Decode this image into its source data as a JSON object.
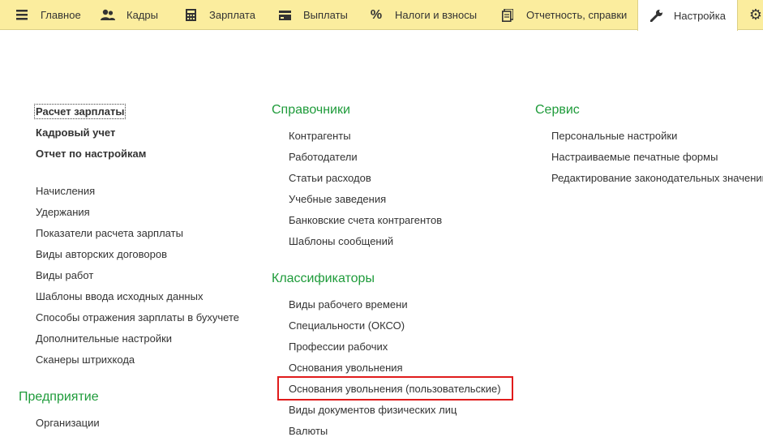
{
  "nav": {
    "tabs": [
      {
        "label": "Главное",
        "icon": "hamburger-menu-icon"
      },
      {
        "label": "Кадры",
        "icon": "people-icon"
      },
      {
        "label": "Зарплата",
        "icon": "calculator-icon"
      },
      {
        "label": "Выплаты",
        "icon": "wallet-icon"
      },
      {
        "label": "Налоги и взносы",
        "icon": "percent-icon"
      },
      {
        "label": "Отчетность, справки",
        "icon": "documents-icon"
      },
      {
        "label": "Настройка",
        "icon": "wrench-icon"
      }
    ],
    "extra_icon": "gear-icon"
  },
  "left": {
    "bold_links": [
      "Расчет зарплаты",
      "Кадровый учет",
      "Отчет по настройкам"
    ],
    "links": [
      "Начисления",
      "Удержания",
      "Показатели расчета зарплаты",
      "Виды авторских договоров",
      "Виды работ",
      "Шаблоны ввода исходных данных",
      "Способы отражения зарплаты в бухучете",
      "Дополнительные настройки",
      "Сканеры штрихкода"
    ],
    "section2_title": "Предприятие",
    "section2_links": [
      "Организации"
    ]
  },
  "middle": {
    "section1_title": "Справочники",
    "section1_links": [
      "Контрагенты",
      "Работодатели",
      "Статьи расходов",
      "Учебные заведения",
      "Банковские счета контрагентов",
      "Шаблоны сообщений"
    ],
    "section2_title": "Классификаторы",
    "section2_links": [
      "Виды рабочего времени",
      "Специальности (ОКСО)",
      "Профессии рабочих",
      "Основания увольнения",
      "Основания увольнения (пользовательские)",
      "Виды документов физических лиц",
      "Валюты"
    ]
  },
  "right": {
    "title": "Сервис",
    "links": [
      "Персональные настройки",
      "Настраиваемые печатные формы",
      "Редактирование законодательных значений"
    ]
  },
  "colors": {
    "topbar": "#fbed9e",
    "section_title": "#1e9b3a",
    "highlight": "#e01b1b"
  }
}
